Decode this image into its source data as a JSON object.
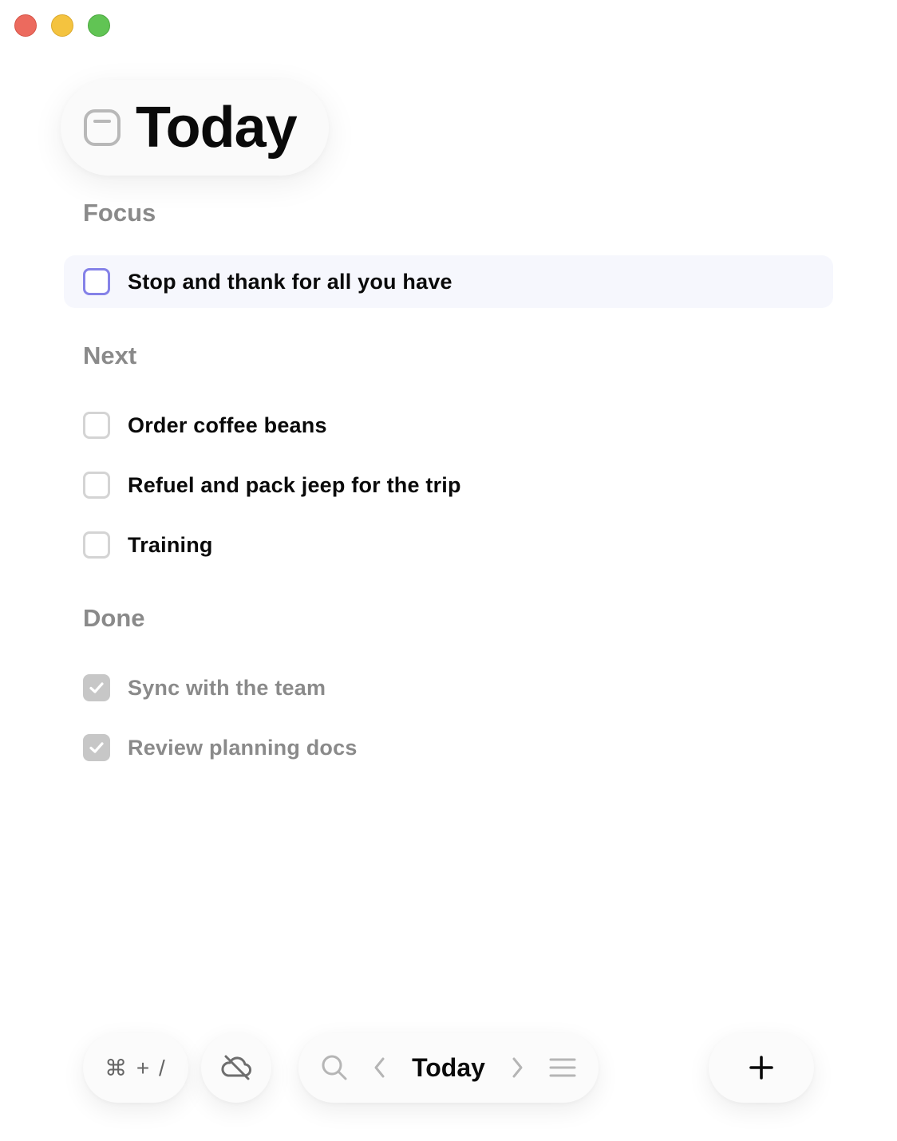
{
  "window": {
    "controls": [
      "close",
      "minimize",
      "zoom"
    ]
  },
  "header": {
    "title": "Today",
    "icon": "today-icon"
  },
  "sections": {
    "focus": {
      "label": "Focus",
      "tasks": [
        {
          "label": "Stop and thank for all you have",
          "checked": false
        }
      ]
    },
    "next": {
      "label": "Next",
      "tasks": [
        {
          "label": "Order coffee beans",
          "checked": false
        },
        {
          "label": "Refuel and pack jeep for the trip",
          "checked": false
        },
        {
          "label": "Training",
          "checked": false
        }
      ]
    },
    "done": {
      "label": "Done",
      "tasks": [
        {
          "label": "Sync with the team",
          "checked": true
        },
        {
          "label": "Review planning docs",
          "checked": true
        }
      ]
    }
  },
  "toolbar": {
    "shortcut_label": "⌘ + /",
    "cloud_icon": "cloud-off-icon",
    "search_icon": "search-icon",
    "prev_icon": "chevron-left-icon",
    "nav_title": "Today",
    "next_icon": "chevron-right-icon",
    "menu_icon": "menu-icon",
    "add_icon": "plus-icon"
  },
  "colors": {
    "accent": "#8582e8",
    "focus_bg": "#f6f7fd",
    "section_text": "#8a8a8a",
    "done_check": "#c7c7c7"
  }
}
